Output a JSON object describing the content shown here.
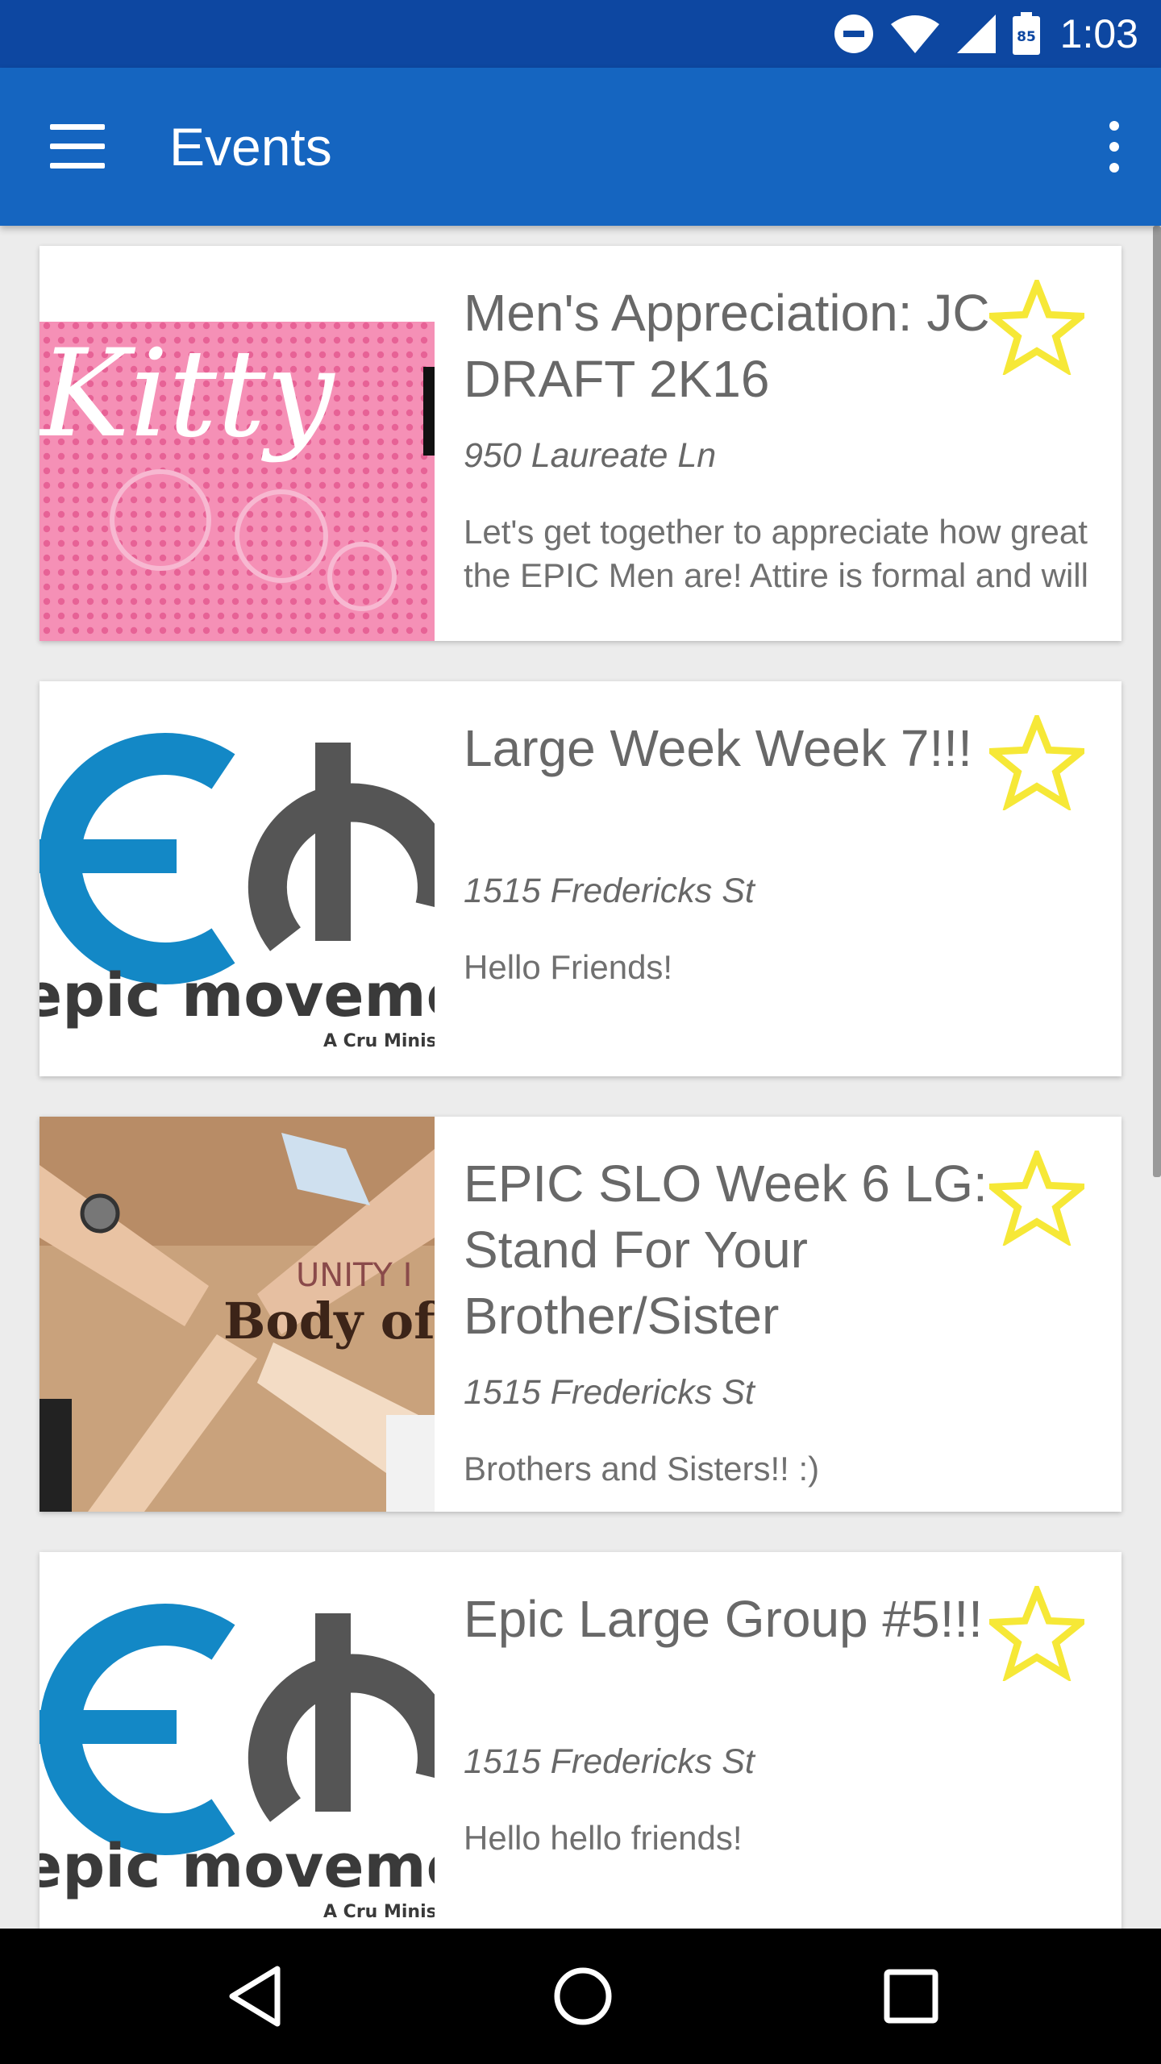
{
  "status_bar": {
    "time": "1:03",
    "battery_level": "85",
    "icons": [
      "dnd-icon",
      "wifi-icon",
      "signal-icon",
      "battery-icon"
    ]
  },
  "app_bar": {
    "title": "Events",
    "menu_icon": "hamburger-menu-icon",
    "overflow_icon": "more-vert-icon"
  },
  "events": [
    {
      "title": "Men's Appreciation: JC DRAFT 2K16",
      "address": "950 Laureate Ln",
      "description": "Let's get together to appreciate how great the EPIC Men are! Attire is formal and will have a setting of",
      "image_text": "Kitty",
      "starred": false
    },
    {
      "title": "Large Week Week 7!!!",
      "address": "1515 Fredericks St",
      "description": "Hello Friends!",
      "image_text": "epic movement",
      "image_subtext": "A Cru Ministry",
      "starred": false
    },
    {
      "title": "EPIC SLO Week 6 LG: Stand For Your Brother/Sister",
      "address": "1515 Fredericks St",
      "description": "Brothers and Sisters!! :)",
      "image_line1": "UNITY I",
      "image_line2": "Body of C",
      "starred": false
    },
    {
      "title": "Epic Large Group #5!!!",
      "address": "1515 Fredericks St",
      "description": "Hello hello friends!",
      "image_text": "epic movement",
      "image_subtext": "A Cru Ministry",
      "starred": false
    }
  ],
  "nav_bar": {
    "buttons": [
      "back-icon",
      "home-icon",
      "recents-icon"
    ]
  },
  "colors": {
    "status_bar": "#0d47a1",
    "app_bar": "#1565c0",
    "star": "#f6e837",
    "epic_blue": "#1388c6",
    "epic_gray": "#555555"
  }
}
